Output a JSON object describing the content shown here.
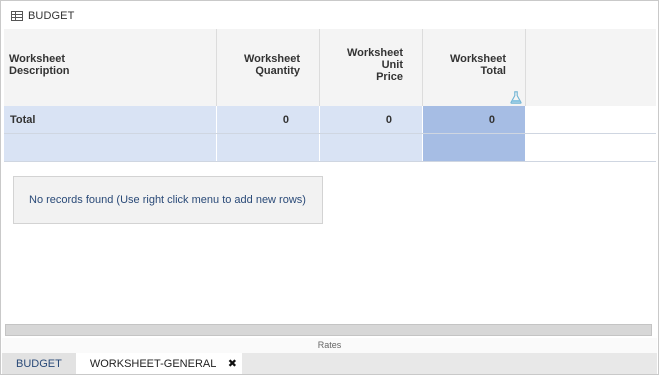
{
  "panel": {
    "title": "BUDGET",
    "icon": "table-icon"
  },
  "grid": {
    "columns": [
      {
        "line1": "Worksheet",
        "line2": "Description",
        "line3": ""
      },
      {
        "line1": "Worksheet",
        "line2": "Quantity",
        "line3": ""
      },
      {
        "line1": "Worksheet",
        "line2": "Unit",
        "line3": "Price"
      },
      {
        "line1": "Worksheet",
        "line2": "Total",
        "line3": ""
      }
    ],
    "total_row": {
      "label": "Total",
      "quantity": "0",
      "unit_price": "0",
      "total": "0"
    },
    "formula_icon": "flask-icon"
  },
  "empty_message": "No records found (Use right click menu to add new rows)",
  "footer_label": "Rates",
  "tabs": [
    {
      "label": "BUDGET"
    },
    {
      "label": "WORKSHEET-GENERAL",
      "close": "✖"
    }
  ],
  "colors": {
    "row_fill": "#d9e3f4",
    "selected_column": "#a6bde4",
    "link_text": "#2a4a78"
  }
}
